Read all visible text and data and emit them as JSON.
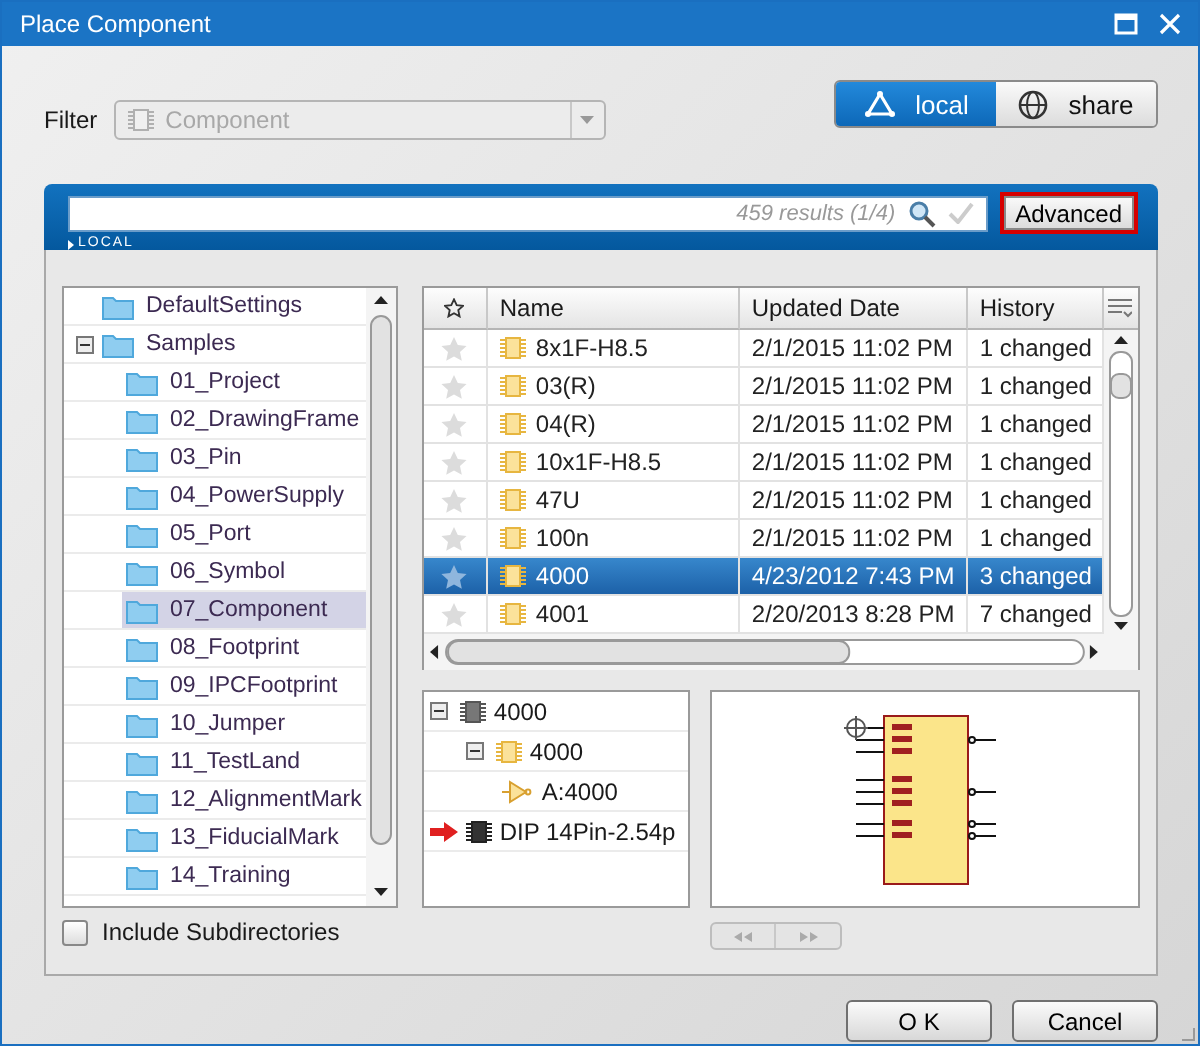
{
  "window": {
    "title": "Place Component"
  },
  "filter": {
    "label": "Filter",
    "value": "Component",
    "disabled": true
  },
  "repository_tabs": [
    {
      "kind": "local",
      "label": "local",
      "selected": true
    },
    {
      "kind": "share",
      "label": "share",
      "selected": false
    }
  ],
  "search": {
    "results": "459 results (1/4)",
    "scope": "LOCAL",
    "advanced_button": "Advanced"
  },
  "folders": [
    {
      "label": "DefaultSettings",
      "selected": false
    },
    {
      "label": "Samples",
      "selected": false,
      "expanded": true,
      "children": [
        {
          "label": "01_Project",
          "selected": false
        },
        {
          "label": "02_DrawingFrame",
          "selected": false
        },
        {
          "label": "03_Pin",
          "selected": false
        },
        {
          "label": "04_PowerSupply",
          "selected": false
        },
        {
          "label": "05_Port",
          "selected": false
        },
        {
          "label": "06_Symbol",
          "selected": false
        },
        {
          "label": "07_Component",
          "selected": true
        },
        {
          "label": "08_Footprint",
          "selected": false
        },
        {
          "label": "09_IPCFootprint",
          "selected": false
        },
        {
          "label": "10_Jumper",
          "selected": false
        },
        {
          "label": "11_TestLand",
          "selected": false
        },
        {
          "label": "12_AlignmentMark",
          "selected": false
        },
        {
          "label": "13_FiducialMark",
          "selected": false
        },
        {
          "label": "14_Training",
          "selected": false
        }
      ]
    }
  ],
  "include_subdirectories": {
    "label": "Include Subdirectories",
    "checked": false
  },
  "table": {
    "columns": [
      "Name",
      "Updated Date",
      "History"
    ],
    "rows": [
      {
        "favorite": false,
        "selected": false,
        "name": "8x1F-H8.5",
        "date": "2/1/2015 11:02 PM",
        "history": "1 changed"
      },
      {
        "favorite": false,
        "selected": false,
        "name": "03(R)",
        "date": "2/1/2015 11:02 PM",
        "history": "1 changed"
      },
      {
        "favorite": false,
        "selected": false,
        "name": "04(R)",
        "date": "2/1/2015 11:02 PM",
        "history": "1 changed"
      },
      {
        "favorite": false,
        "selected": false,
        "name": "10x1F-H8.5",
        "date": "2/1/2015 11:02 PM",
        "history": "1 changed"
      },
      {
        "favorite": false,
        "selected": false,
        "name": "47U",
        "date": "2/1/2015 11:02 PM",
        "history": "1 changed"
      },
      {
        "favorite": false,
        "selected": false,
        "name": "100n",
        "date": "2/1/2015 11:02 PM",
        "history": "1 changed"
      },
      {
        "favorite": false,
        "selected": true,
        "name": "4000",
        "date": "4/23/2012 7:43 PM",
        "history": "3 changed"
      },
      {
        "favorite": false,
        "selected": false,
        "name": "4001",
        "date": "2/20/2013 8:28 PM",
        "history": "7 changed"
      }
    ]
  },
  "structure": [
    {
      "kind": "component",
      "label": "4000",
      "expanded": true,
      "children": [
        {
          "kind": "part",
          "label": "4000",
          "expanded": true,
          "children": [
            {
              "kind": "gate",
              "label": "A:4000"
            }
          ]
        }
      ]
    },
    {
      "kind": "footprint",
      "label": "DIP 14Pin-2.54p",
      "current": true
    }
  ],
  "buttons": [
    {
      "label": "O K"
    },
    {
      "label": "Cancel"
    }
  ]
}
